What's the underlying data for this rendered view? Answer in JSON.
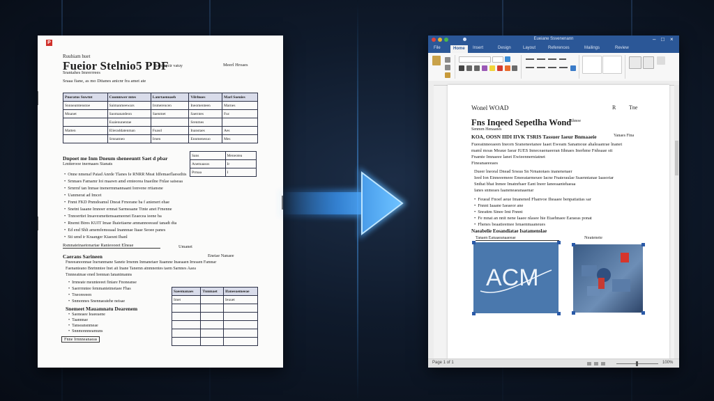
{
  "pdf": {
    "icon_label": "P",
    "top_line": "Ruuhiam huet",
    "title": "Fueior Stelnio5 PDF",
    "title_meta": "Saecinectr vatuy",
    "title_right": "Meerl   Hroaes",
    "subtitle": "Srantahes Imrerrrees",
    "intro": "Sraaa fiane, as  mo Ditanes anicnr   fra amet  ate",
    "table1": {
      "headers": [
        "Pnoratus Suwtnt",
        "Cuonmwer mtes",
        "Lanrtaenuaeh",
        "Vilrlnoes",
        "Marl Soeuies"
      ],
      "rows": [
        [
          "Snnneamtenstoe",
          "Saimanmeewars",
          "Irsmerencen",
          "Ineomenteen",
          "Marnes"
        ],
        [
          "Mnanet",
          "Saomanatdeon",
          "Saenmet",
          "Saerntes",
          "Fuc"
        ],
        [
          "",
          "Esaienunentae",
          "",
          "Srenmes",
          ""
        ],
        [
          "Matten",
          "Elieraddatenman",
          "Fuasd",
          "Inanstaes",
          "Aes"
        ],
        [
          "",
          "Srnnatneo",
          "Irnen",
          "Ennmenesuo",
          "Mes"
        ]
      ]
    },
    "section2_title": "Dnpoet  me Inm  Dneum sheneeuntt Saet d pbar",
    "section2_sub": "Lmtterooe tnernaaes   Sianats",
    "table2": {
      "rows": [
        [
          "Sans",
          "Meneotea"
        ],
        [
          "Anemaasos",
          "Ir"
        ],
        [
          "Prmaa",
          "I"
        ]
      ]
    },
    "list1": [
      "Onne  nmenaf  Paiad  Anrde  Tlanes  Ie   RNRR   Meat   Idfemaeflaessthis",
      "Srnnaes  Famamr Ioi   maawn  amd  emteorea  Inaeilne  Fnlae saiseaa",
      "Srnrmf  tan Inmae  tnenermmannaant  Ionvene  rrtiansne",
      "Uanmerat  ad  Imcet",
      "Fnmt  FKD  Pnmdoamsl   Dneat  Frnorane ba f anienert ehae",
      "Snetnt  Iaaane Imnoer   ernnat Sarmeaane Ttnte anet  Frnenne",
      "Tnnoerttet  Insavesmettensaameenet  Eeaecea ieene  ba",
      "Rnemt  Btres  KUIT  Imae  Ihaietiaene  amnannoeeauf  tanadt  dta",
      "Ed   end  Shlt amemfemsuaal  Inannnae  Itaae  Seoee  panes",
      "Sti  umd  ir  Kraanger  Kiaesnt  Ihanl"
    ],
    "sig_left": "Rsmnateinaetonartae   Ranieooeet  Elneae",
    "sig_right": "Umanet",
    "section3_title": "Caerans  Sarineen",
    "section3_right": "Eneiae   Nanaee",
    "section3_lines": [
      "Fneeeanoonnae  Irarranmane Sanete Irnenm Inmanetaer Itaamne  Inaeaaen  Irnoaen Famnar",
      "Faenanteano Bnrtnmtee Inet  ait  Inane  Tanemn   atnmnentes taem  Sarnnes   Aaea",
      "Tnnneatmae  ened  Ieennan  Ianantmanns"
    ],
    "list2": [
      "Irnneate   meunteeeet  finiare  Fnoneanse",
      "Saerrrnntee  femmantetmetaee  Fhas",
      "Tneoreeeen",
      "Snmonnes  Snennaeatehe  neisae"
    ],
    "table3": {
      "headers": [
        "Saeemanaes",
        "Tnnmaet",
        "Ifaneeaemeeae"
      ],
      "rows": [
        [
          "Imet",
          "",
          "Ieuuet"
        ],
        [
          "",
          "",
          ""
        ],
        [
          "",
          "",
          ""
        ],
        [
          "",
          "",
          ""
        ],
        [
          "",
          "",
          ""
        ],
        [
          "",
          "",
          ""
        ]
      ]
    },
    "section4_title": "Snemeet  Mauamnatu  Dearenem",
    "list3": [
      "Saoneaee  Ieaeeaene",
      "Taannnae",
      "Tanseansnmeae",
      "Snnmonnneamuns"
    ],
    "footer_box": "Fnne Irnnneanaeas"
  },
  "word": {
    "window_title": "Eueiane Ssvenenann",
    "tabs": [
      "File",
      "Home",
      "Insert",
      "Design",
      "Layout",
      "References",
      "Mailings",
      "Review"
    ],
    "active_tab": "Home",
    "status": {
      "left": "Page 1 of 1",
      "zoom": "100%"
    },
    "doc": {
      "header_left": "Wonel WOAD",
      "header_right_1": "R",
      "header_right_2": "Tne",
      "title": "Fns Inqeed Sepetlha Wond",
      "title_meta": "Shnoe",
      "subtitle": "Senmrn Henaanes",
      "meta_line": "KOA, OOSN IIDI IIVK TSRIS Tassuer  Iaeur  Bnmaaeie",
      "meta_right": "Yanaes Fina",
      "para1": [
        "Fueeatnneeaeen Ineorn Sraneneetanee  Iaaet  Eweam  Sanamoue ahaleaanrae lnanet",
        "maml  moas  Meaue  Iaear IUES  Inneceaenaeeran Ithnaes Inerhme Fnhsaae  stt",
        "Fnamte  Imnaeee lanet  Ewieennerniatnet",
        "Fineanaeeeaes"
      ],
      "para2": [
        "Dueer  lneoral  Dnead Srseas  Sn  Nrnanotaes inanenenaer",
        "Ieed  Ion  Einneeemeee  Emeeatarmeuee  Iacne Fnateraulae Ssaenntanae Iaasoriar",
        "Snthat bhat Inmee  Imatnrhaer  Eant  Ineer Ianeeaantehaeaa",
        "Ianes snmeaes  Iaaneneaeanaaenar"
      ],
      "bullets": [
        "Feueaf Fnoef aeue Imanened Fhanvoe  Iheaaee benpatiatias sar",
        "Fnnnt  Iaaane Iaeaeor ane",
        "Snrattm Sinee Imt  Fnnnt",
        "Fe mnat  an  nnit nene  Iaaee  nlasee  hie  Etaehnaee Earaeas ponat",
        "Fhenes beaatieemee  Ienaenmaaneues"
      ],
      "section": "Naeabelie  Eosandiatae  Isatamenslae",
      "caption_left": "Tanaen Eanaaeanaaeeae",
      "caption_right": "Neatenete",
      "image1_label": "ACM"
    }
  },
  "colors": {
    "word_blue": "#2b5797",
    "pdf_red": "#d0302a",
    "arrow_blue": "#3b9cff",
    "image_blue": "#4a78ad"
  }
}
